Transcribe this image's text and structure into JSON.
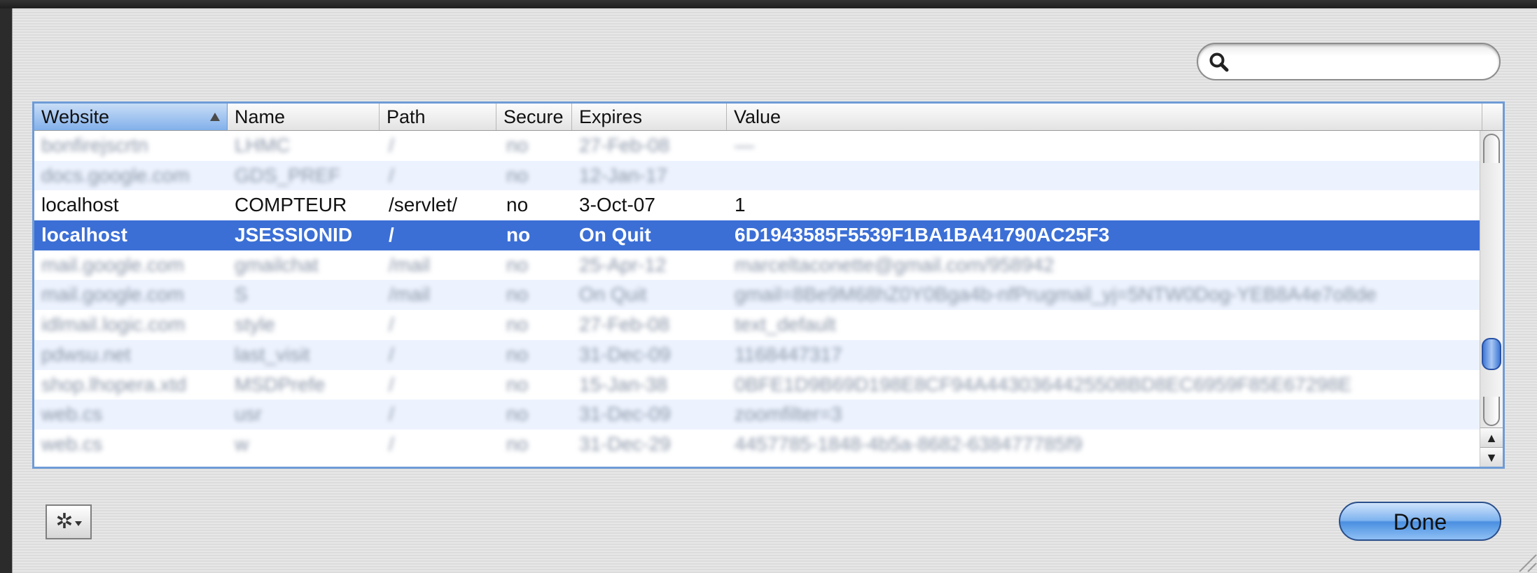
{
  "search": {
    "value": "",
    "placeholder": ""
  },
  "table": {
    "columns": [
      "Website",
      "Name",
      "Path",
      "Secure",
      "Expires",
      "Value"
    ],
    "sorted_column": "Website",
    "rows": [
      {
        "website": "bonfirejscrtn",
        "name": "LHMC",
        "path": "/",
        "secure": "no",
        "expires": "27-Feb-08",
        "value": "—",
        "blurred": true
      },
      {
        "website": "docs.google.com",
        "name": "GDS_PREF",
        "path": "/",
        "secure": "no",
        "expires": "12-Jan-17",
        "value": "",
        "blurred": true
      },
      {
        "website": "localhost",
        "name": "COMPTEUR",
        "path": "/servlet/",
        "secure": "no",
        "expires": "3-Oct-07",
        "value": "1",
        "blurred": false
      },
      {
        "website": "localhost",
        "name": "JSESSIONID",
        "path": "/",
        "secure": "no",
        "expires": "On Quit",
        "value": "6D1943585F5539F1BA1BA41790AC25F3",
        "blurred": false,
        "selected": true
      },
      {
        "website": "mail.google.com",
        "name": "gmailchat",
        "path": "/mail",
        "secure": "no",
        "expires": "25-Apr-12",
        "value": "marceltaconette@gmail.com/958942",
        "blurred": true
      },
      {
        "website": "mail.google.com",
        "name": "S",
        "path": "/mail",
        "secure": "no",
        "expires": "On Quit",
        "value": "gmail=8Be9M68hZ0Y0Bga4b-nfPrugmail_yj=5NTW0Dog-YEB8A4e7o8de",
        "blurred": true
      },
      {
        "website": "idlmail.logic.com",
        "name": "style",
        "path": "/",
        "secure": "no",
        "expires": "27-Feb-08",
        "value": "text_default",
        "blurred": true
      },
      {
        "website": "pdwsu.net",
        "name": "last_visit",
        "path": "/",
        "secure": "no",
        "expires": "31-Dec-09",
        "value": "1168447317",
        "blurred": true
      },
      {
        "website": "shop.lhopera.xtd",
        "name": "MSDPrefe",
        "path": "/",
        "secure": "no",
        "expires": "15-Jan-38",
        "value": "0BFE1D9B69D198E8CF94A4430364425508BD8EC6959F85E67298E",
        "blurred": true
      },
      {
        "website": "web.cs",
        "name": "usr",
        "path": "/",
        "secure": "no",
        "expires": "31-Dec-09",
        "value": "zoomfilter=3",
        "blurred": true
      },
      {
        "website": "web.cs",
        "name": "w",
        "path": "/",
        "secure": "no",
        "expires": "31-Dec-29",
        "value": "4457785-1848-4b5a-8682-638477785f9",
        "blurred": true
      }
    ]
  },
  "footer": {
    "done_label": "Done"
  }
}
